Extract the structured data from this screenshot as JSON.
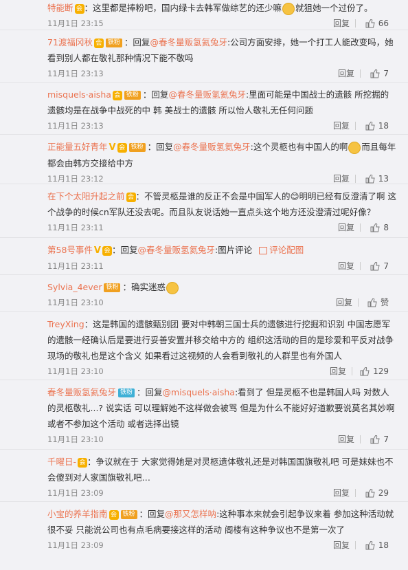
{
  "comments": [
    {
      "user": "特能断",
      "content": "：这里都是捧粉吧，国内绿卡去韩军做综艺的还少嘛",
      "after": "就狙她一个过份了。",
      "time": "11月1日 23:15",
      "reply": "回复",
      "likes": "66"
    },
    {
      "user": "71渡福冈秋",
      "badge": "铁粉",
      "content": "：回复",
      "mention": "@春冬量贩氢氦兔牙",
      "rest": ":公司方面安排，她一个打工人能改变吗，她看到别人都在敬礼那种情况下能不敬吗",
      "time": "11月1日 23:13",
      "reply": "回复",
      "likes": "7"
    },
    {
      "user": "misquels·aisha",
      "badge": "铁粉",
      "content": "：回复",
      "mention": "@春冬量贩氢氦兔牙",
      "rest": ":里面可能是中国战士的遗骸 所挖掘的遗骸均是在战争中战死的中 韩 美战士的遗骸 所以怡人敬礼无任何问题",
      "time": "11月1日 23:13",
      "reply": "回复",
      "likes": "18"
    },
    {
      "user": "正能量五好青年",
      "badge": "铁粉",
      "content": "：回复",
      "mention": "@春冬量贩氢氦兔牙",
      "rest": ":这个灵柩也有中国人的啊",
      "after": "而且每年都会由韩方交接给中方",
      "time": "11月1日 23:12",
      "reply": "回复",
      "likes": "13"
    },
    {
      "user": "在下个太阳升起之前",
      "content": "：不管灵柩是谁的反正不会是中国军人的😊明明已经有反澄清了啊 这个战争的时候cn军队还没去呢。而且队友说话她一直点头这个地方还没澄清过呢好像？",
      "time": "11月1日 23:11",
      "reply": "回复",
      "likes": "8"
    },
    {
      "user": "第58号事件",
      "content": "：回复",
      "mention": "@春冬量贩氢氦兔牙",
      "rest": ":图片评论",
      "piclink": "评论配图",
      "time": "11月1日 23:11",
      "reply": "回复",
      "likes": "7"
    },
    {
      "user": "Sylvia_4ever",
      "badge": "铁粉",
      "content": "：确实迷惑",
      "time": "11月1日 23:10",
      "reply": "回复",
      "likes": "赞"
    },
    {
      "user": "TreyXing",
      "content": "：这是韩国的遗骸甄别团 要对中韩朝三国士兵的遗骸进行挖掘和识别 中国志愿军的遗骸一经确认后是要进行妥善安置并移交给中方的 组织这活动的目的是珍爱和平反对战争 现场的敬礼也是这个含义 如果看过这视频的人会看到敬礼的人群里也有外国人",
      "time": "11月1日 23:10",
      "reply": "回复",
      "likes": "129"
    },
    {
      "user": "春冬量贩氢氦兔牙",
      "badge": "铁粉",
      "badge_type": "iron",
      "content": "：回复",
      "mention": "@misquels·aisha",
      "rest": ":看到了 但是灵柩不也是韩国人吗 对数人的灵柩敬礼...? 说实话 可以理解她不这样做会被骂 但是为什么不能好好道歉要说莫名其妙啊 或者不参加这个活动 或者选择出镜",
      "time": "11月1日 23:10",
      "reply": "回复",
      "likes": "7"
    },
    {
      "user": "千曜日-",
      "content": "：争议就在于 大家觉得她是对灵柩遗体敬礼还是对韩国国旗敬礼吧 可是妹妹也不会傻到对人家国旗敬礼吧…",
      "time": "11月1日 23:09",
      "reply": "回复",
      "likes": "29"
    },
    {
      "user": "小宝的养羊指南",
      "badge": "铁粉",
      "content": "：回复",
      "mention": "@那又怎样呐",
      "rest": ":这种事本来就会引起争议来着 参加这种活动就很不妥 只能说公司也有点毛病要接这样的活动 阁楼有这种争议也不是第一次了",
      "time": "11月1日 23:09",
      "reply": "回复",
      "likes": "18"
    }
  ],
  "icons": {
    "like": "thumb-up-icon",
    "picture": "picture-icon",
    "vip": "vip-badge-icon",
    "emoji": "emoji-icon"
  }
}
